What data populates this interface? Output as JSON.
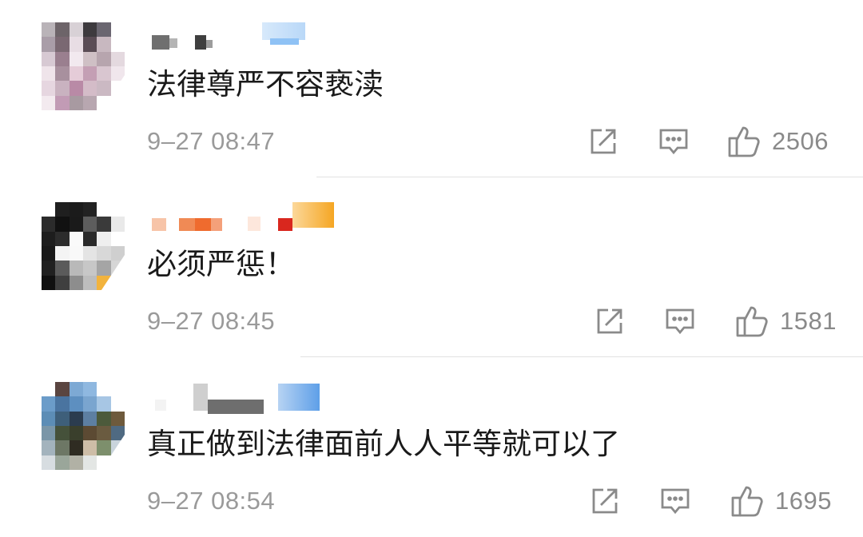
{
  "comments": [
    {
      "text": "法律尊严不容亵渎",
      "time": "9–27 08:47",
      "likes": "2506"
    },
    {
      "text": "必须严惩！",
      "time": "9–27 08:45",
      "likes": "1581"
    },
    {
      "text": "真正做到法律面前人人平等就可以了",
      "time": "9–27 08:54",
      "likes": "1695"
    }
  ],
  "icons": {
    "share": "share-icon",
    "comment": "comment-icon",
    "like": "thumbs-up-icon"
  },
  "colors": {
    "text": "#1a1a1a",
    "meta": "#9a9a9a",
    "icon": "#8a8a8a",
    "divider": "#e2e2e2",
    "badge_orange": "#f5a623",
    "badge_blue": "#8fc2f5"
  }
}
